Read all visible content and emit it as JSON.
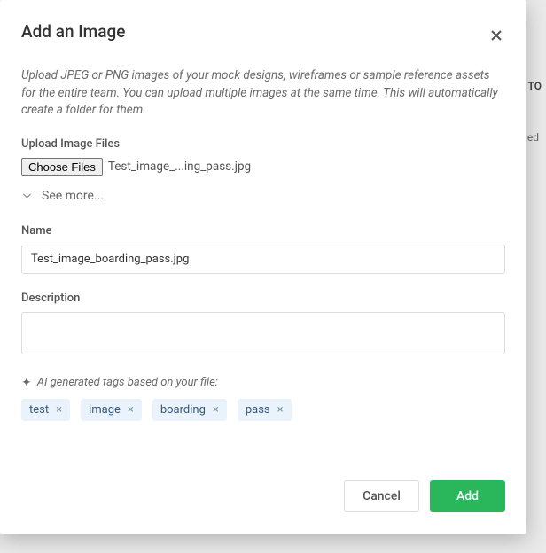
{
  "backdrop": {
    "fragment_to": "TO",
    "fragment_ed": "ed"
  },
  "modal": {
    "title": "Add an Image",
    "intro": "Upload JPEG or PNG images of your mock designs, wireframes or sample reference assets for the entire team. You can upload multiple images at the same time. This will automatically create a folder for them.",
    "upload_label": "Upload Image Files",
    "choose_files_label": "Choose Files",
    "selected_file_display": "Test_image_...ing_pass.jpg",
    "see_more_label": "See more...",
    "name_label": "Name",
    "name_value": "Test_image_boarding_pass.jpg",
    "description_label": "Description",
    "description_value": "",
    "ai_tags_label": "AI generated tags based on your file:",
    "tags": [
      {
        "label": "test"
      },
      {
        "label": "image"
      },
      {
        "label": "boarding"
      },
      {
        "label": "pass"
      }
    ],
    "cancel_label": "Cancel",
    "add_label": "Add"
  }
}
